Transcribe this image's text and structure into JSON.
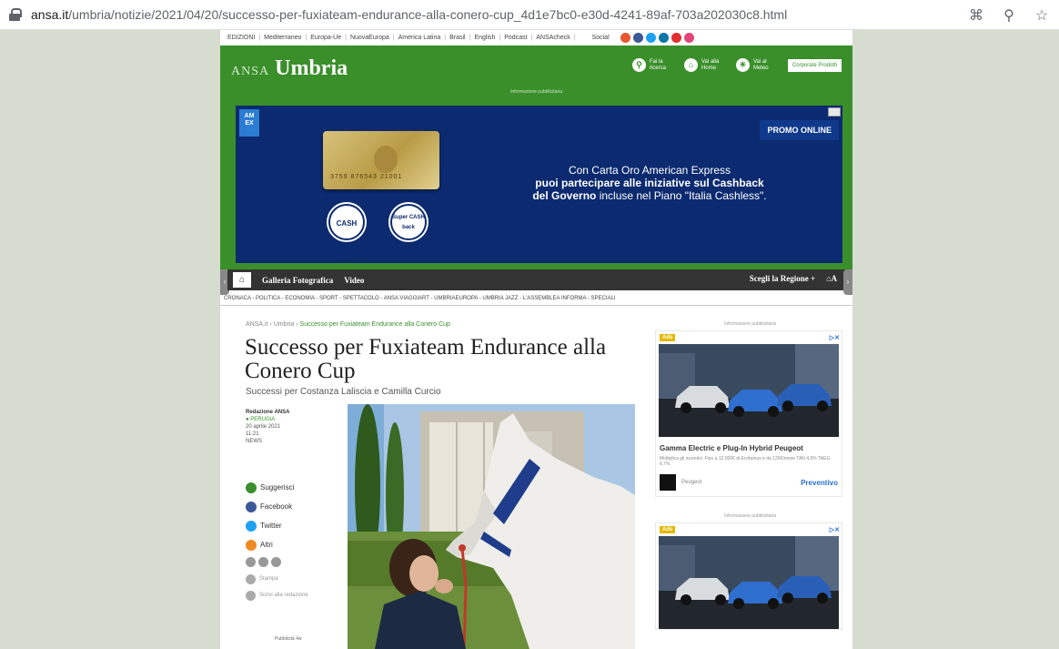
{
  "browser": {
    "url_domain": "ansa.it",
    "url_path": "/umbria/notizie/2021/04/20/successo-per-fuxiateam-endurance-alla-conero-cup_4d1e7bc0-e30d-4241-89af-703a202030c8.html",
    "icons": [
      "qr-icon",
      "zoom-icon",
      "star-icon"
    ]
  },
  "topstrip": {
    "items": [
      "EDIZIONI",
      "Mediterraneo",
      "Europa-Ue",
      "NuovaEuropa",
      "America Latina",
      "Brasil",
      "English",
      "Podcast",
      "ANSAcheck"
    ],
    "social_label": "Social"
  },
  "header": {
    "brand_prefix": "ANSA",
    "brand_region": "Umbria",
    "links": [
      {
        "label": "Fai la ricerca",
        "icon": "search-icon"
      },
      {
        "label": "Vai alla Home",
        "icon": "home-icon"
      },
      {
        "label": "Vai al Meteo",
        "icon": "weather-icon"
      }
    ],
    "corporate_label": "Corporate Prodotti",
    "ad_info": "Informazione pubblicitaria"
  },
  "banner": {
    "amex": "AM EX",
    "promo": "PROMO ONLINE",
    "card_number": "3759 876543 21001",
    "cashback_1": "CASH back",
    "cashback_2": "Super CASH back",
    "line1": "Con Carta Oro American Express",
    "line2": "puoi partecipare alle iniziative sul Cashback",
    "line3_bold": "del Governo",
    "line3_rest": " incluse nel Piano \"Italia Cashless\"."
  },
  "nav": {
    "links": [
      "Galleria Fotografica",
      "Video"
    ],
    "region_label": "Scegli la Regione +",
    "right_icon_label": "A"
  },
  "sections": "CRONACA - POLITICA - ECONOMIA - SPORT - SPETTACOLO - ANSA VIAGGIART - UMBRIAEUROPA - UMBRIA JAZZ - L'ASSEMBLEA INFORMA - SPECIALI",
  "article": {
    "breadcrumb": [
      "ANSA.it",
      "Umbria"
    ],
    "breadcrumb_current": "Successo per Fuxiateam Endurance alla Conero Cup",
    "title": "Successo per Fuxiateam Endurance alla Conero Cup",
    "subtitle": "Successi per Costanza Laliscia e Camilla Curcio",
    "author": "Redazione ANSA",
    "place": "PERUGIA",
    "date": "20 aprile 2021",
    "time": "11:21",
    "tag": "NEWS"
  },
  "share": {
    "items": [
      {
        "label": "Suggerisci",
        "color": "#3a8f2b"
      },
      {
        "label": "Facebook",
        "color": "#3b5998"
      },
      {
        "label": "Twitter",
        "color": "#1da1f2"
      },
      {
        "label": "Altri",
        "color": "#f08a24"
      }
    ],
    "stampa": "Stampa",
    "scrivi": "Scrivi alla redazione",
    "pubby": "Pubblicità 4w"
  },
  "sidebar": {
    "ad_info": "Informazione pubblicitaria",
    "ad_badge": "Ads",
    "ad_title": "Gamma Electric e Plug-In Hybrid Peugeot",
    "ad_desc": "Moltiplica gli incentivi. Fino a 12.000€ di Ecobonus e da 129€/mese TAN 4,5% TAEG 6,7%",
    "ad_brand": "Peugeot",
    "ad_cta": "Preventivo"
  }
}
